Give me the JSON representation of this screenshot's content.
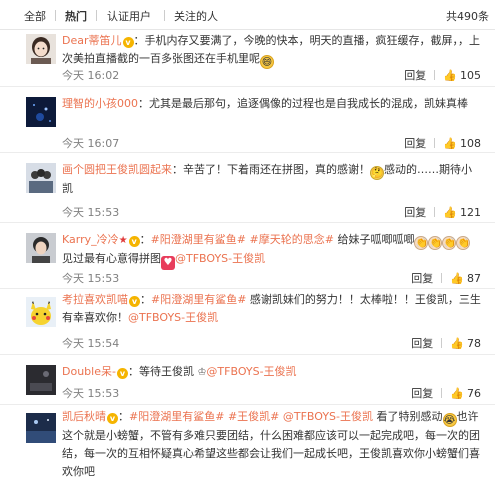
{
  "tabs": [
    {
      "label": "全部",
      "active": false
    },
    {
      "label": "热门",
      "active": true
    },
    {
      "label": "认证用户",
      "active": false
    },
    {
      "label": "关注的人",
      "active": false
    }
  ],
  "total": "共490条",
  "actions": {
    "reply": "回复"
  },
  "colors": {
    "username": "#eb7350",
    "meta": "#808080",
    "vip": "#f5b400"
  },
  "comments": [
    {
      "user": "Dear蒂笛儿",
      "segments": [
        {
          "t": "text",
          "v": "：手机内存又要满了，今晚的快本，明天的直播，疯狂缓存，截屏，，上次美拍直播截的一百多张图还在手机里呢"
        }
      ],
      "time": "今天 16:02",
      "likes": "105",
      "avatar_icon": "avatar-girl-icon"
    },
    {
      "user": "理智的小孩000",
      "segments": [
        {
          "t": "text",
          "v": "：尤其是最后那句，追逐偶像的过程也是自我成长的混成，凯妹真棒"
        }
      ],
      "time": "今天 16:07",
      "likes": "108",
      "avatar_icon": "avatar-night-icon"
    },
    {
      "user": "画个圆把王俊凯圆起来",
      "segments": [
        {
          "t": "text",
          "v": "：辛苦了！下着雨还在拼图，真的感谢！"
        },
        {
          "t": "text",
          "v": "感动的……期待小凯"
        }
      ],
      "time": "今天 15:53",
      "likes": "121",
      "avatar_icon": "avatar-group-icon"
    },
    {
      "user": "Karry_冷冷",
      "segments": [
        {
          "t": "text",
          "v": "："
        },
        {
          "t": "topic",
          "v": "#阳澄湖里有鲨鱼#"
        },
        {
          "t": "text",
          "v": " "
        },
        {
          "t": "topic",
          "v": "#摩天轮的思念#"
        },
        {
          "t": "text",
          "v": " 给妹子呱唧呱唧"
        },
        {
          "t": "text",
          "v": "见过最有心意得拼图"
        },
        {
          "t": "at",
          "v": "@TFBOYS-王俊凯"
        }
      ],
      "time": "今天 15:53",
      "likes": "87",
      "avatar_icon": "avatar-boy-icon"
    },
    {
      "user": "考拉喜欢凯喵",
      "segments": [
        {
          "t": "text",
          "v": "："
        },
        {
          "t": "topic",
          "v": "#阳澄湖里有鲨鱼#"
        },
        {
          "t": "text",
          "v": " 感谢凯妹们的努力！！太棒啦！！王俊凯，三生有幸喜欢你！"
        },
        {
          "t": "at",
          "v": "@TFBOYS-王俊凯"
        }
      ],
      "time": "今天 15:54",
      "likes": "78",
      "avatar_icon": "avatar-pikachu-icon"
    },
    {
      "user": "Double呆-",
      "segments": [
        {
          "t": "text",
          "v": "：等待王俊凯 "
        },
        {
          "t": "at",
          "v": "@TFBOYS-王俊凯"
        }
      ],
      "time": "今天 15:53",
      "likes": "76",
      "avatar_icon": "avatar-dark-icon"
    },
    {
      "user": "凯后秋晴",
      "segments": [
        {
          "t": "text",
          "v": "："
        },
        {
          "t": "topic",
          "v": "#阳澄湖里有鲨鱼#"
        },
        {
          "t": "text",
          "v": " "
        },
        {
          "t": "topic",
          "v": "#王俊凯#"
        },
        {
          "t": "text",
          "v": " "
        },
        {
          "t": "at",
          "v": "@TFBOYS-王俊凯"
        },
        {
          "t": "text",
          "v": " 看了特别感动"
        },
        {
          "t": "text",
          "v": "也许这个就是小螃蟹，不管有多难只要团结，什么困难都应该可以一起完成吧，每一次的团结，每一次的互相怀疑真心希望这些都会让我们一起成长吧，王俊凯喜欢你小螃蟹们喜欢你吧"
        }
      ],
      "time": "",
      "likes": "",
      "avatar_icon": "avatar-sky-icon"
    }
  ]
}
